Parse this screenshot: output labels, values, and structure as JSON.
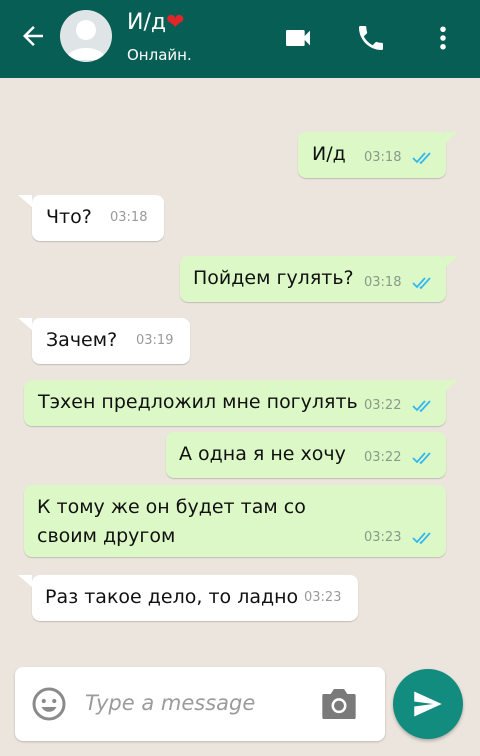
{
  "header": {
    "contact_name": "И/д",
    "heart": "❤",
    "status": "Онлайн.",
    "icons": [
      "back-arrow-icon",
      "avatar",
      "video-call-icon",
      "phone-icon",
      "more-vert-icon"
    ]
  },
  "messages": [
    {
      "direction": "out",
      "text": "И/д",
      "time": "03:18",
      "read": true
    },
    {
      "direction": "in",
      "text": "Что?",
      "time": "03:18"
    },
    {
      "direction": "out",
      "text": "Пойдем гулять?",
      "time": "03:18",
      "read": true
    },
    {
      "direction": "in",
      "text": "Зачем?",
      "time": "03:19"
    },
    {
      "direction": "out",
      "text": "Тэхен предложил мне погулять",
      "time": "03:22",
      "read": true
    },
    {
      "direction": "out",
      "text": "А одна я не хочу",
      "time": "03:22",
      "read": true
    },
    {
      "direction": "out",
      "text_line1": "К тому же он будет там со",
      "text_line2": "своим другом",
      "time": "03:23",
      "read": true
    },
    {
      "direction": "in",
      "text": "Раз такое дело, то ладно",
      "time": "03:23"
    }
  ],
  "composer": {
    "placeholder": "Type a message"
  },
  "colors": {
    "header": "#075e54",
    "outgoing_bubble": "#dcf8c6",
    "incoming_bubble": "#ffffff",
    "read_ticks": "#34b7f1",
    "send_button": "#128c7e",
    "background": "#ece5dd"
  }
}
